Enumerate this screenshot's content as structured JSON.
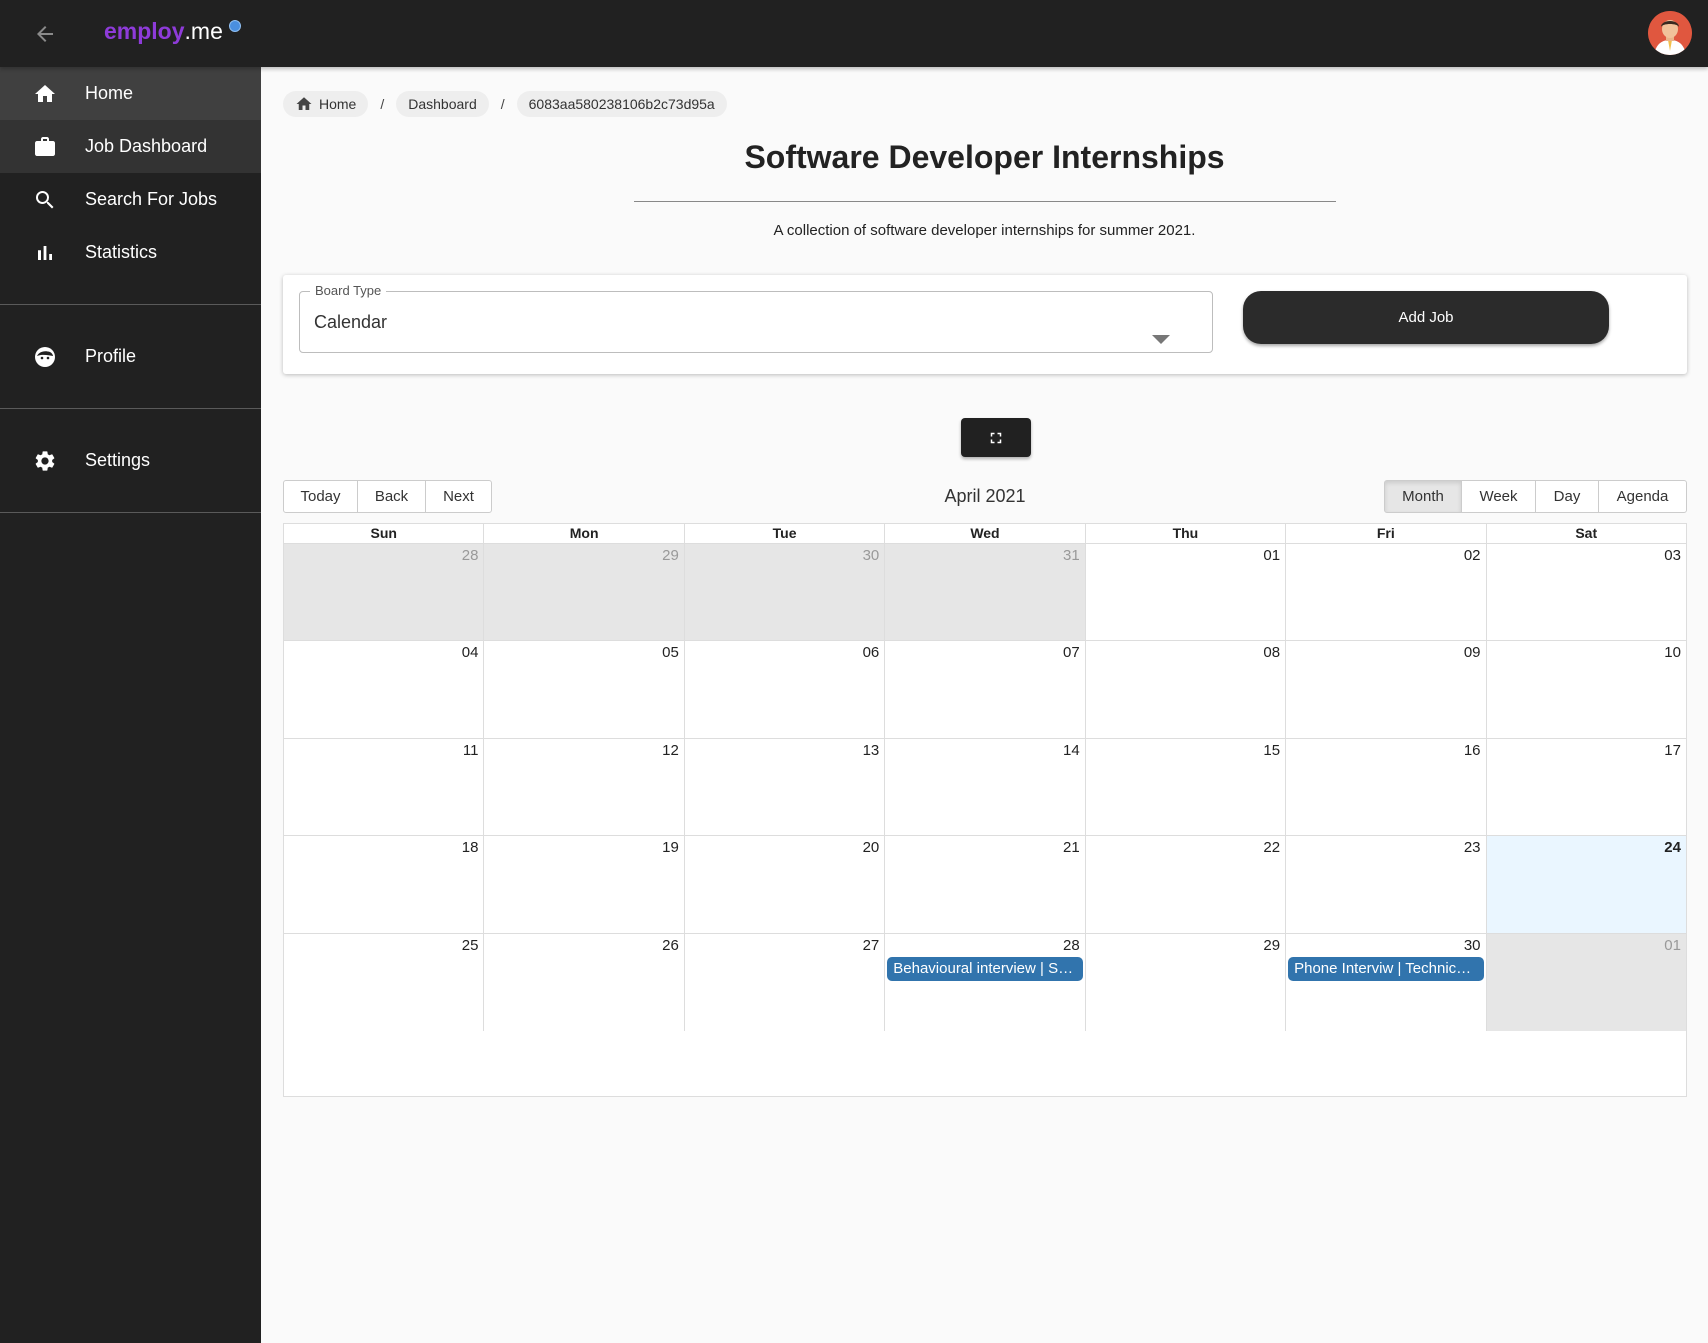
{
  "app": {
    "logo_part1": "employ",
    "logo_part2": ".me"
  },
  "sidebar": {
    "items": [
      {
        "label": "Home",
        "icon": "home-icon"
      },
      {
        "label": "Job Dashboard",
        "icon": "briefcase-icon"
      },
      {
        "label": "Search For Jobs",
        "icon": "search-icon"
      },
      {
        "label": "Statistics",
        "icon": "bar-chart-icon"
      }
    ],
    "profile_label": "Profile",
    "settings_label": "Settings"
  },
  "breadcrumb": {
    "home": "Home",
    "dashboard": "Dashboard",
    "board_id": "6083aa580238106b2c73d95a",
    "separator": "/"
  },
  "board": {
    "title": "Software Developer Internships",
    "description": "A collection of software developer internships for summer 2021."
  },
  "controls": {
    "board_type_label": "Board Type",
    "board_type_value": "Calendar",
    "add_job_label": "Add Job"
  },
  "calendar": {
    "nav_buttons": [
      "Today",
      "Back",
      "Next"
    ],
    "label": "April 2021",
    "views": [
      "Month",
      "Week",
      "Day",
      "Agenda"
    ],
    "active_view": "Month",
    "weekdays": [
      "Sun",
      "Mon",
      "Tue",
      "Wed",
      "Thu",
      "Fri",
      "Sat"
    ],
    "weeks": [
      [
        {
          "d": "28",
          "off": true
        },
        {
          "d": "29",
          "off": true
        },
        {
          "d": "30",
          "off": true
        },
        {
          "d": "31",
          "off": true
        },
        {
          "d": "01"
        },
        {
          "d": "02"
        },
        {
          "d": "03"
        }
      ],
      [
        {
          "d": "04"
        },
        {
          "d": "05"
        },
        {
          "d": "06"
        },
        {
          "d": "07"
        },
        {
          "d": "08"
        },
        {
          "d": "09"
        },
        {
          "d": "10"
        }
      ],
      [
        {
          "d": "11"
        },
        {
          "d": "12"
        },
        {
          "d": "13"
        },
        {
          "d": "14"
        },
        {
          "d": "15"
        },
        {
          "d": "16"
        },
        {
          "d": "17"
        }
      ],
      [
        {
          "d": "18"
        },
        {
          "d": "19"
        },
        {
          "d": "20"
        },
        {
          "d": "21"
        },
        {
          "d": "22"
        },
        {
          "d": "23"
        },
        {
          "d": "24",
          "today": true
        }
      ],
      [
        {
          "d": "25"
        },
        {
          "d": "26"
        },
        {
          "d": "27"
        },
        {
          "d": "28",
          "event": "Behavioural interview | Software Developer Intern"
        },
        {
          "d": "29"
        },
        {
          "d": "30",
          "event": "Phone Interviw | Technical Intern"
        },
        {
          "d": "01",
          "off": true
        }
      ]
    ]
  },
  "colors": {
    "brand_purple": "#8e3bd9",
    "event_blue": "#3174ad",
    "today_bg": "#eaf6ff"
  }
}
